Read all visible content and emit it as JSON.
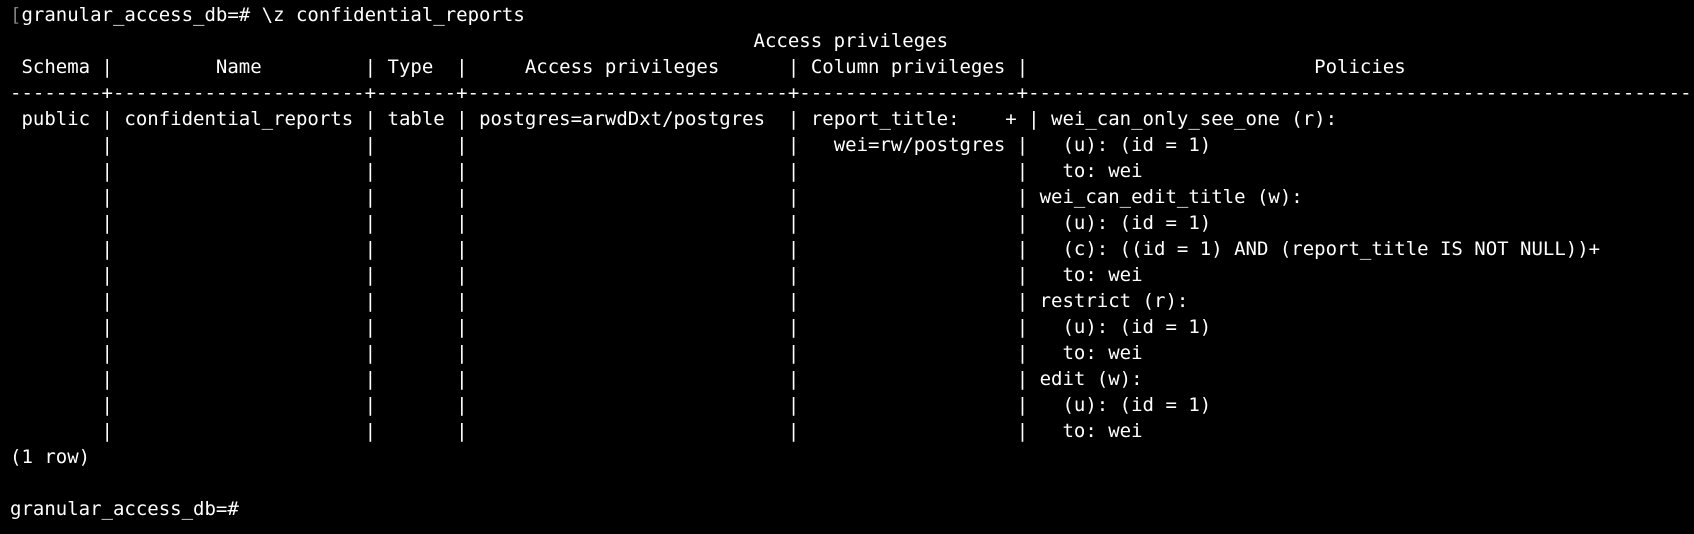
{
  "terminal": {
    "colors": {
      "background": "#000000",
      "foreground": "#ffffff"
    },
    "command_line": {
      "prompt": "granular_access_db=# ",
      "command": "\\z confidential_reports"
    },
    "table": {
      "caption": "Access privileges",
      "headers": [
        "Schema",
        "Name",
        "Type",
        "Access privileges",
        "Column privileges",
        "Policies"
      ],
      "separator": "--------+----------------------+-------+----------------------------+-------------------+------------------------------------------------------------",
      "rows": [
        [
          "public",
          "confidential_reports",
          "table",
          "postgres=arwdDxt/postgres",
          "report_title:    +",
          "wei_can_only_see_one (r):                                  +"
        ],
        [
          "",
          "",
          "",
          "",
          "  wei=rw/postgres",
          "  (u): (id = 1)                                            +"
        ],
        [
          "",
          "",
          "",
          "",
          "",
          "  to: wei                                                   +"
        ],
        [
          "",
          "",
          "",
          "",
          "",
          "wei_can_edit_title (w):                                    +"
        ],
        [
          "",
          "",
          "",
          "",
          "",
          "  (u): (id = 1)                                            +"
        ],
        [
          "",
          "",
          "",
          "",
          "",
          "  (c): ((id = 1) AND (report_title IS NOT NULL))+"
        ],
        [
          "",
          "",
          "",
          "",
          "",
          "  to: wei                                                   +"
        ],
        [
          "",
          "",
          "",
          "",
          "",
          "restrict (r):                                              +"
        ],
        [
          "",
          "",
          "",
          "",
          "",
          "  (u): (id = 1)                                            +"
        ],
        [
          "",
          "",
          "",
          "",
          "",
          "  to: wei                                                   +"
        ],
        [
          "",
          "",
          "",
          "",
          "",
          "edit (w):                                                  +"
        ],
        [
          "",
          "",
          "",
          "",
          "",
          "  (u): (id = 1)                                            +"
        ],
        [
          "",
          "",
          "",
          "",
          "",
          "  to: wei"
        ]
      ],
      "row_count": "(1 row)"
    },
    "final_prompt": "granular_access_db=# "
  }
}
